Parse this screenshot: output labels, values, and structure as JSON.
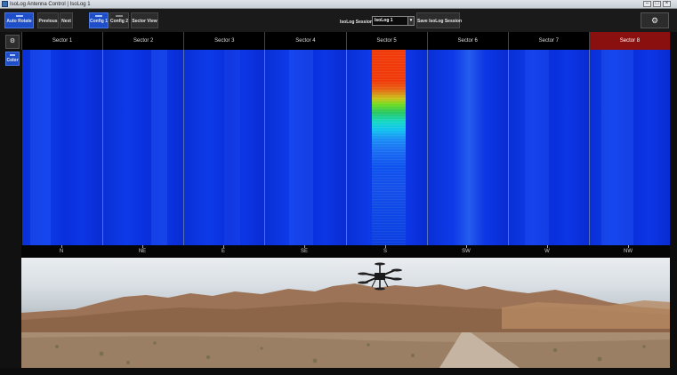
{
  "window": {
    "title": "IsoLog Antenna Control | IsoLog 1",
    "controls": [
      "–",
      "□",
      "×"
    ]
  },
  "toolbar": {
    "auto_rotate": "Auto Rotate",
    "previous": "Previous",
    "next": "Next",
    "config1": "Config 1",
    "config2": "Config 2",
    "sector_view": "Sector View",
    "session_label": "IsoLog Session:",
    "session_value": "IsoLog 1",
    "save_session": "Save IsoLog Session",
    "settings_icon": "gear-icon",
    "settings_glyph": "⚙"
  },
  "side_panel": {
    "gear_glyph": "⚙",
    "color_button": "Color"
  },
  "sectors": [
    "Sector 1",
    "Sector 2",
    "Sector 3",
    "Sector 4",
    "Sector 5",
    "Sector 6",
    "Sector 7",
    "Sector 8"
  ],
  "active_alert_sector": "Sector 8",
  "heatmap": {
    "hot_sector": "Sector 5",
    "colors": {
      "background": "#0a2fd8",
      "hot_top": "#f03a0a",
      "mid": "#6fdc22",
      "cool": "#12c2f0"
    }
  },
  "compass": [
    "N",
    "NE",
    "E",
    "SE",
    "S",
    "SW",
    "W",
    "NW"
  ],
  "colors": {
    "accent": "#1f4fc8",
    "alert": "#8a1010"
  }
}
